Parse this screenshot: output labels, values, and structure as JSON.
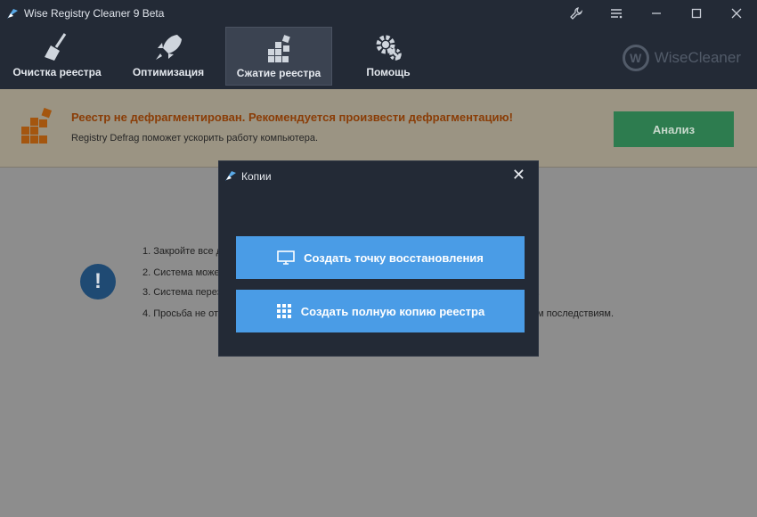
{
  "window": {
    "title": "Wise Registry Cleaner 9 Beta"
  },
  "toolbar": {
    "items": [
      {
        "label": "Очистка реестра",
        "icon": "broom-icon"
      },
      {
        "label": "Оптимизация",
        "icon": "rocket-icon"
      },
      {
        "label": "Сжатие реестра",
        "icon": "blocks-icon",
        "active": true
      },
      {
        "label": "Помощь",
        "icon": "gears-icon"
      }
    ],
    "brand": "WiseCleaner",
    "brand_mark": "W"
  },
  "banner": {
    "warning": "Реестр не дефрагментирован. Рекомендуется произвести дефрагментацию!",
    "subtitle": "Registry Defrag поможет ускорить работу компьютера.",
    "analyze_label": "Анализ"
  },
  "steps": [
    "1. Закройте все д",
    "2. Система може",
    "3. Система перез",
    "4. Просьба не от"
  ],
  "steps_tail": [
    "",
    "",
    ".",
    "м последствиям."
  ],
  "info_mark": "!",
  "modal": {
    "title": "Копии",
    "close": "✕",
    "restore_point_label": "Создать точку восстановления",
    "full_backup_label": "Создать полную копию реестра"
  },
  "colors": {
    "titlebar": "#232a36",
    "accent_blue": "#4a9ce6",
    "analyze_green": "#3fae6c",
    "warning_orange": "#c8560a"
  }
}
